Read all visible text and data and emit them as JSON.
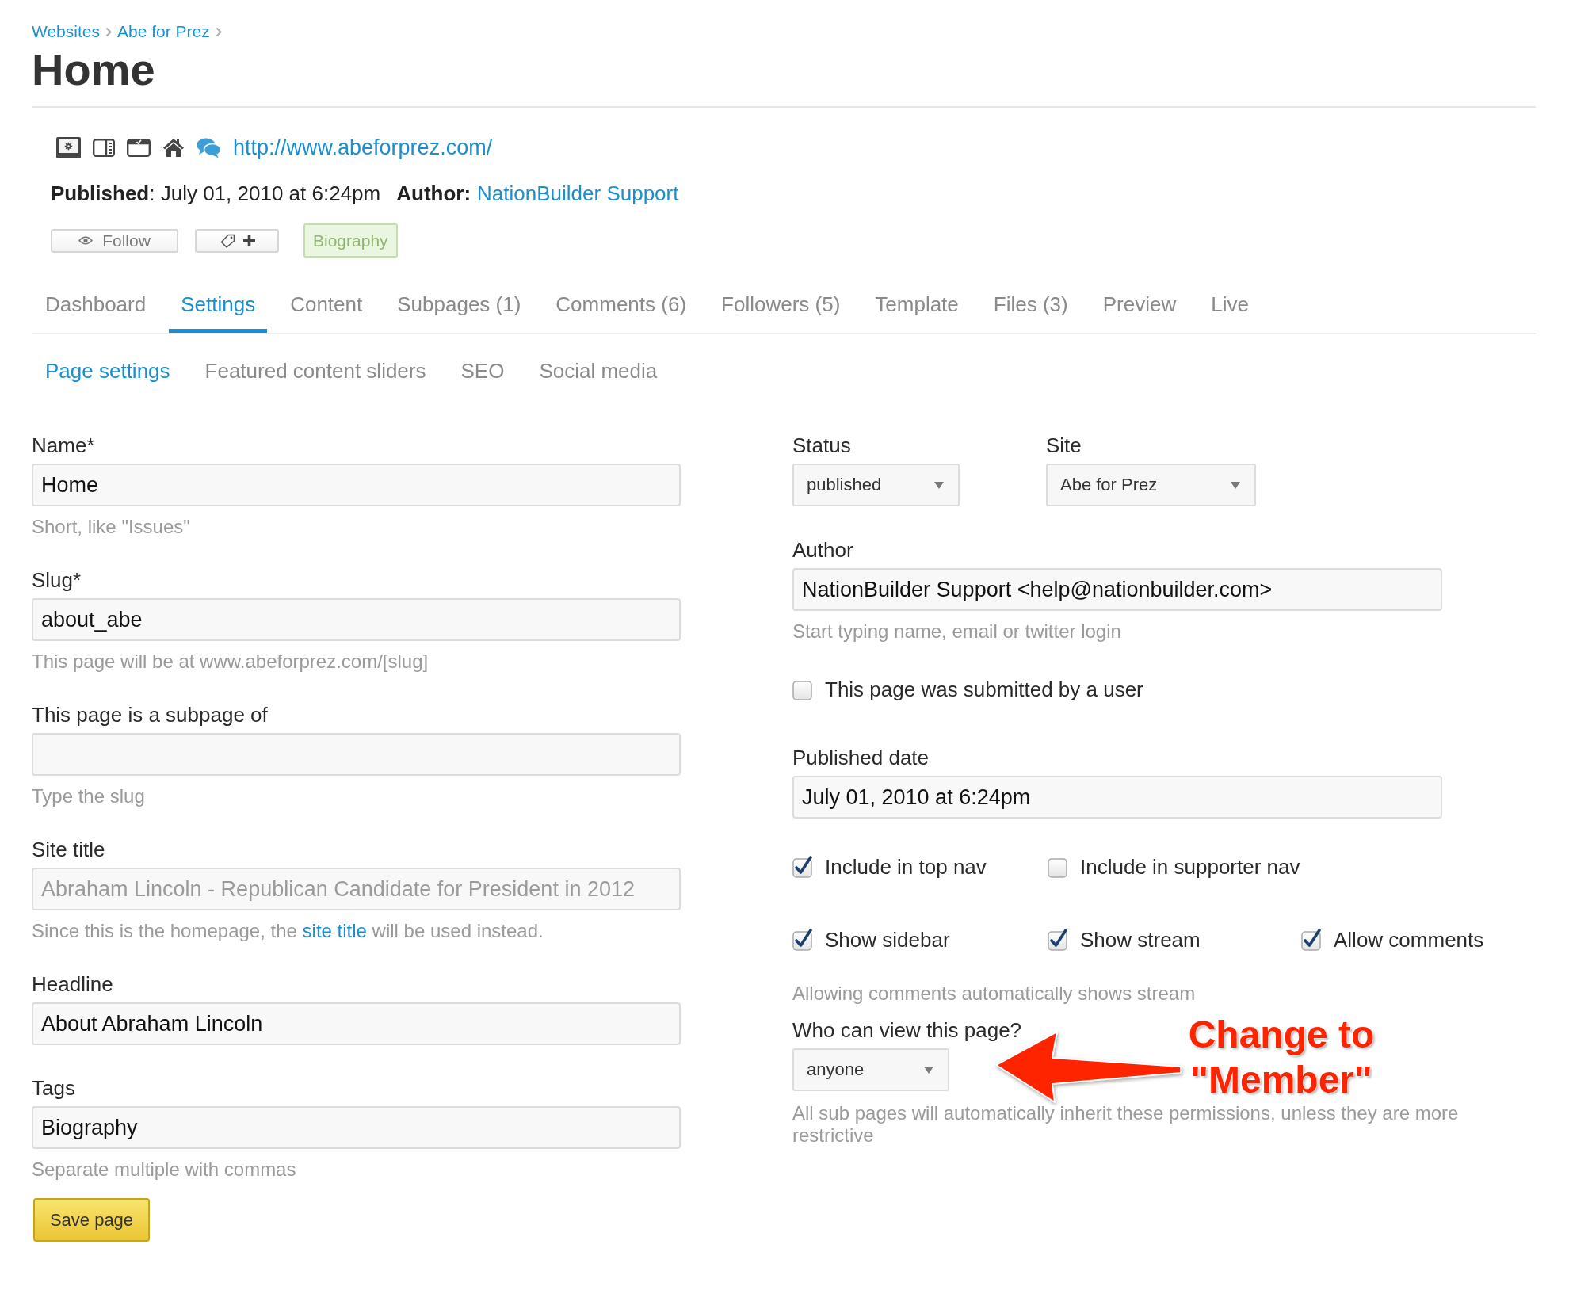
{
  "breadcrumbs": [
    {
      "label": "Websites"
    },
    {
      "label": "Abe for Prez"
    }
  ],
  "title": "Home",
  "page_url": "http://www.abeforprez.com/",
  "published": "**Published**: July 01, 2010 at 6:24pm",
  "author": {
    "label": "Author:",
    "name": "NationBuilder Support"
  },
  "follow_button": "Follow",
  "tags": [
    "Biography"
  ],
  "tabs": [
    {
      "label": "Dashboard",
      "selected": false
    },
    {
      "label": "Settings",
      "selected": true
    },
    {
      "label": "Content",
      "selected": false
    },
    {
      "label": "Subpages (1)",
      "selected": false
    },
    {
      "label": "Comments (6)",
      "selected": false
    },
    {
      "label": "Followers (5)",
      "selected": false
    },
    {
      "label": "Template",
      "selected": false
    },
    {
      "label": "Files (3)",
      "selected": false
    },
    {
      "label": "Preview",
      "selected": false
    },
    {
      "label": "Live",
      "selected": false
    }
  ],
  "subtabs": [
    {
      "label": "Page settings",
      "selected": true
    },
    {
      "label": "Featured content sliders",
      "selected": false
    },
    {
      "label": "SEO",
      "selected": false
    },
    {
      "label": "Social media",
      "selected": false
    }
  ],
  "left_fields": [
    {
      "label": "Name*",
      "value": "Home",
      "hint": "Short, like \"Issues\""
    },
    {
      "label": "Slug*",
      "value": "about_abe",
      "hint": "This page will be at www.abeforprez.com/[slug]"
    },
    {
      "label": "This page is a subpage of",
      "hint": "Type the slug"
    },
    {
      "label": "Site title",
      "placeholder": "Abraham Lincoln - Republican Candidate for President in 2012",
      "hint_parts": {
        "before": "Since this is the homepage, the ",
        "link": "site title",
        "after": " will be used instead."
      }
    },
    {
      "label": "Headline",
      "value": "About Abraham Lincoln"
    },
    {
      "label": "Tags",
      "value": "Biography",
      "hint": "Separate multiple with commas"
    }
  ],
  "save_button": "Save page",
  "right": {
    "selects": [
      {
        "label": "Status",
        "value": "published"
      },
      {
        "label": "Site",
        "value": "Abe for Prez"
      }
    ],
    "author_field": {
      "label": "Author",
      "value": "NationBuilder Support <help@nationbuilder.com>",
      "hint": "Start typing name, email or twitter login"
    },
    "submitted_option": {
      "label": "This page was submitted by a user",
      "checked": false
    },
    "published_date": {
      "label": "Published date",
      "value": "July 01, 2010 at 6:24pm"
    },
    "option_rows": [
      {
        "items": [
          {
            "label": "Include in top nav",
            "checked": true
          },
          {
            "label": "Include in supporter nav",
            "checked": false
          }
        ]
      },
      {
        "items": [
          {
            "label": "Show sidebar",
            "checked": true
          },
          {
            "label": "Show stream",
            "checked": true
          },
          {
            "label": "Allow comments",
            "checked": true
          }
        ]
      }
    ],
    "options_hint": "Allowing comments automatically shows stream",
    "visibility": {
      "label": "Who can view this page?",
      "value": "anyone",
      "hint": "All sub pages will automatically inherit these permissions, unless they are more restrictive"
    }
  },
  "annotation": {
    "lines": [
      "Change to",
      "\"Member\""
    ]
  }
}
